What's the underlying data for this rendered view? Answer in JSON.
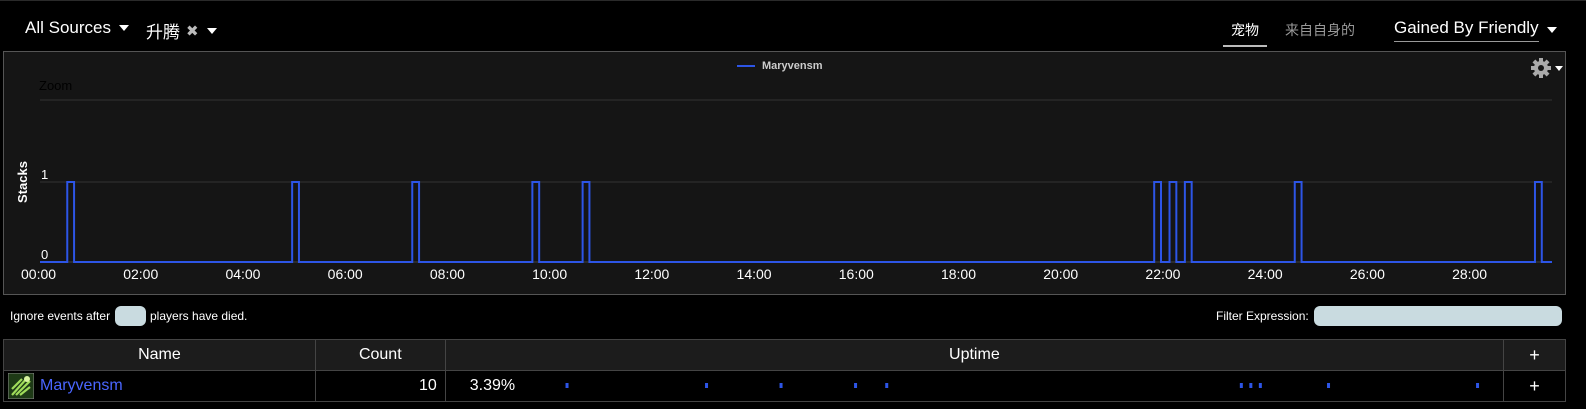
{
  "header": {
    "sources_label": "All Sources",
    "ability_label": "升腾",
    "ability_clear_icon": "x-icon",
    "tabs": [
      {
        "label": "宠物",
        "active": true
      },
      {
        "label": "来自自身的",
        "active": false
      }
    ],
    "gained_label": "Gained By Friendly"
  },
  "chart_data": {
    "type": "line",
    "title": "",
    "zoom_label": "Zoom",
    "ylabel": "Stacks",
    "xlabel": "",
    "ylim": [
      0,
      2
    ],
    "y_ticks": [
      "0",
      "1"
    ],
    "x_ticks": [
      "00:00",
      "02:00",
      "04:00",
      "06:00",
      "08:00",
      "10:00",
      "12:00",
      "14:00",
      "16:00",
      "18:00",
      "20:00",
      "22:00",
      "24:00",
      "26:00",
      "28:00"
    ],
    "legend": {
      "position": "top-center"
    },
    "series": [
      {
        "name": "Maryvensm",
        "color": "#2d55e6",
        "intervals_seconds": [
          [
            32,
            40
          ],
          [
            296,
            304
          ],
          [
            437,
            445
          ],
          [
            578,
            586
          ],
          [
            637,
            645
          ],
          [
            1308,
            1316
          ],
          [
            1326,
            1334
          ],
          [
            1344,
            1352
          ],
          [
            1473,
            1481
          ],
          [
            1755,
            1763
          ]
        ]
      }
    ],
    "x_range_seconds": [
      0,
      1775
    ]
  },
  "filter": {
    "ignore_prefix": "Ignore events after",
    "ignore_suffix": "players have died.",
    "ignore_value": "",
    "expression_label": "Filter Expression:",
    "expression_value": ""
  },
  "table": {
    "headers": {
      "name": "Name",
      "count": "Count",
      "uptime": "Uptime",
      "add": "+"
    },
    "rows": [
      {
        "name": "Maryvensm",
        "icon": "nature-spell-icon",
        "count": "10",
        "uptime": "3.39%",
        "add": "+"
      }
    ]
  }
}
